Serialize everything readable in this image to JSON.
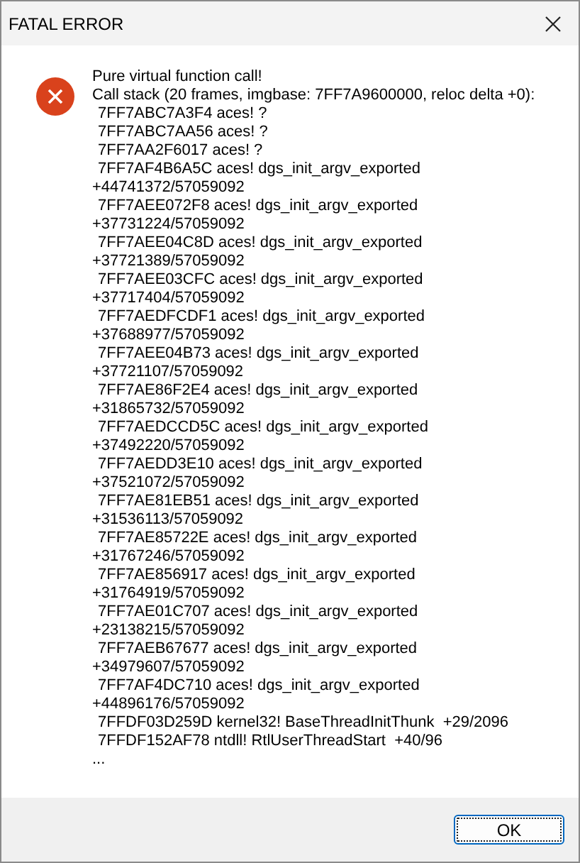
{
  "window": {
    "title": "FATAL ERROR"
  },
  "message": [
    {
      "text": "Pure virtual function call!",
      "indent": false
    },
    {
      "text": "Call stack (20 frames, imgbase: 7FF7A9600000, reloc delta +0):",
      "indent": false
    },
    {
      "text": "7FF7ABC7A3F4 aces! ?",
      "indent": true
    },
    {
      "text": "7FF7ABC7AA56 aces! ?",
      "indent": true
    },
    {
      "text": "7FF7AA2F6017 aces! ?",
      "indent": true
    },
    {
      "text": "7FF7AF4B6A5C aces! dgs_init_argv_exported",
      "indent": true
    },
    {
      "text": "+44741372/57059092",
      "indent": false
    },
    {
      "text": "7FF7AEE072F8 aces! dgs_init_argv_exported",
      "indent": true
    },
    {
      "text": "+37731224/57059092",
      "indent": false
    },
    {
      "text": "7FF7AEE04C8D aces! dgs_init_argv_exported",
      "indent": true
    },
    {
      "text": "+37721389/57059092",
      "indent": false
    },
    {
      "text": "7FF7AEE03CFC aces! dgs_init_argv_exported",
      "indent": true
    },
    {
      "text": "+37717404/57059092",
      "indent": false
    },
    {
      "text": "7FF7AEDFCDF1 aces! dgs_init_argv_exported",
      "indent": true
    },
    {
      "text": "+37688977/57059092",
      "indent": false
    },
    {
      "text": "7FF7AEE04B73 aces! dgs_init_argv_exported",
      "indent": true
    },
    {
      "text": "+37721107/57059092",
      "indent": false
    },
    {
      "text": "7FF7AE86F2E4 aces! dgs_init_argv_exported",
      "indent": true
    },
    {
      "text": "+31865732/57059092",
      "indent": false
    },
    {
      "text": "7FF7AEDCCD5C aces! dgs_init_argv_exported",
      "indent": true
    },
    {
      "text": "+37492220/57059092",
      "indent": false
    },
    {
      "text": "7FF7AEDD3E10 aces! dgs_init_argv_exported",
      "indent": true
    },
    {
      "text": "+37521072/57059092",
      "indent": false
    },
    {
      "text": "7FF7AE81EB51 aces! dgs_init_argv_exported",
      "indent": true
    },
    {
      "text": "+31536113/57059092",
      "indent": false
    },
    {
      "text": "7FF7AE85722E aces! dgs_init_argv_exported",
      "indent": true
    },
    {
      "text": "+31767246/57059092",
      "indent": false
    },
    {
      "text": "7FF7AE856917 aces! dgs_init_argv_exported",
      "indent": true
    },
    {
      "text": "+31764919/57059092",
      "indent": false
    },
    {
      "text": "7FF7AE01C707 aces! dgs_init_argv_exported",
      "indent": true
    },
    {
      "text": "+23138215/57059092",
      "indent": false
    },
    {
      "text": "7FF7AEB67677 aces! dgs_init_argv_exported",
      "indent": true
    },
    {
      "text": "+34979607/57059092",
      "indent": false
    },
    {
      "text": "7FF7AF4DC710 aces! dgs_init_argv_exported",
      "indent": true
    },
    {
      "text": "+44896176/57059092",
      "indent": false
    },
    {
      "text": "7FFDF03D259D kernel32! BaseThreadInitThunk  +29/2096",
      "indent": true
    },
    {
      "text": "7FFDF152AF78 ntdll! RtlUserThreadStart  +40/96",
      "indent": true
    },
    {
      "text": "...",
      "indent": false
    }
  ],
  "buttons": [
    {
      "label": "OK"
    }
  ]
}
